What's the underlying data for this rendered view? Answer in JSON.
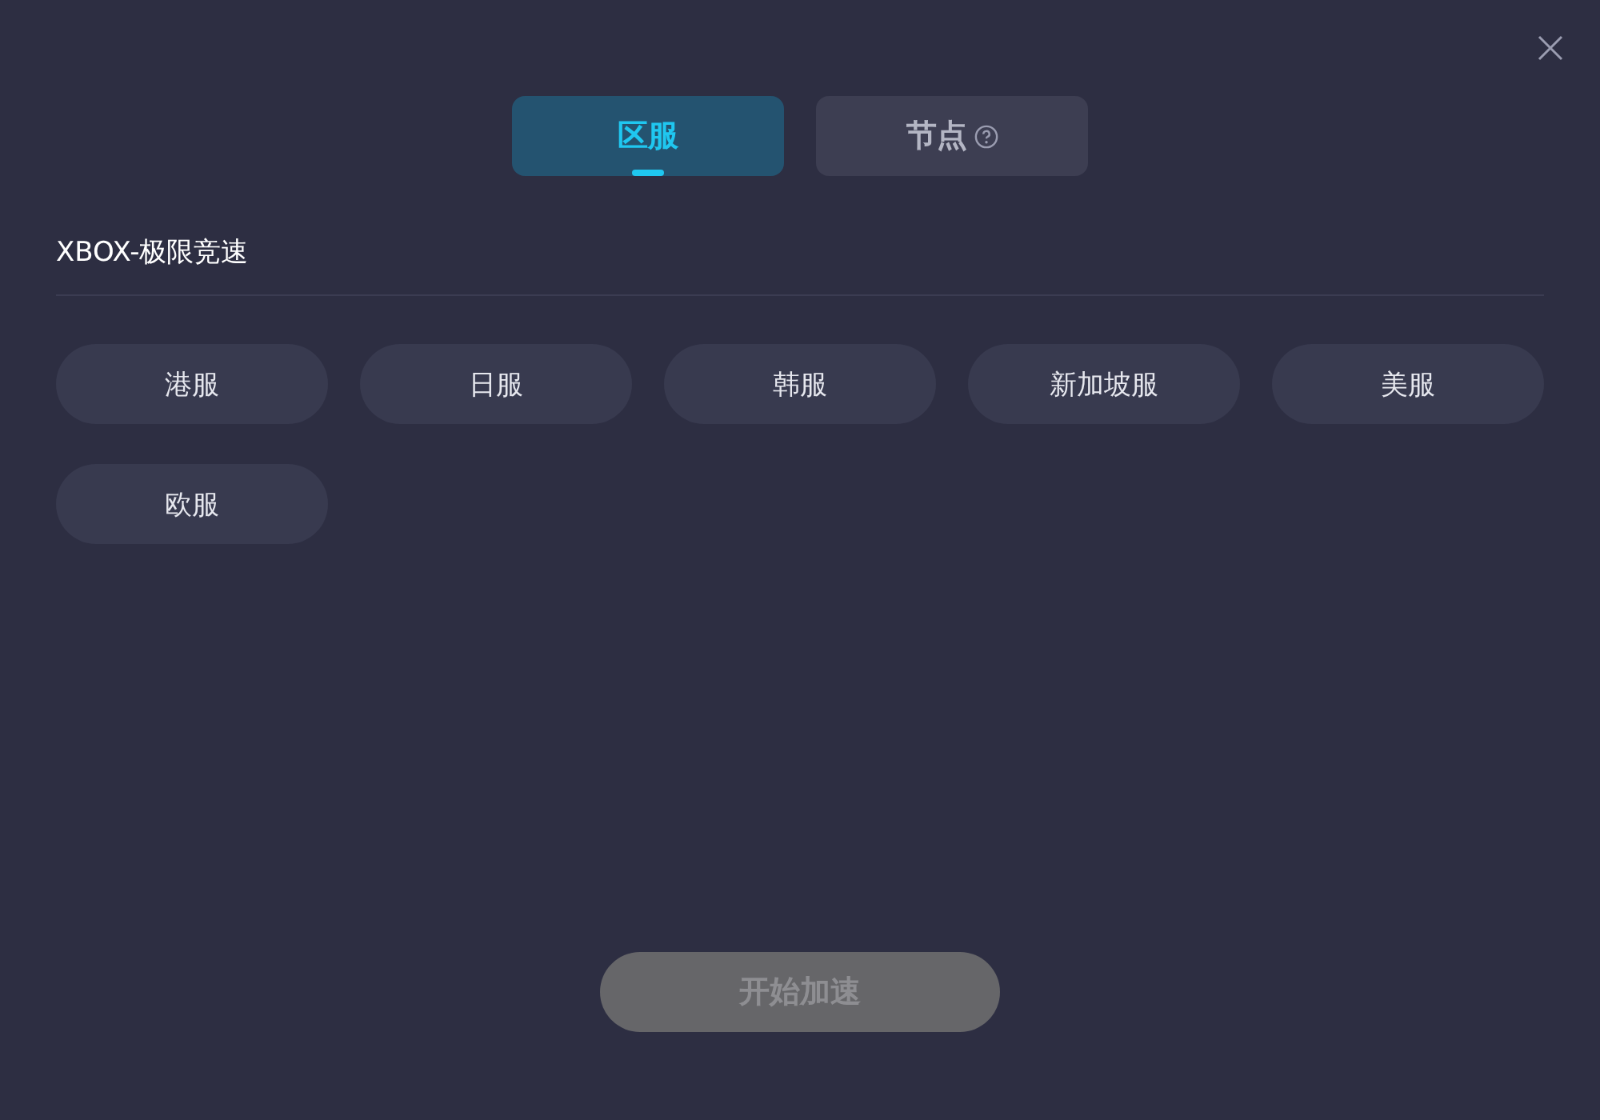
{
  "tabs": [
    {
      "label": "区服",
      "selected": true,
      "help": false
    },
    {
      "label": "节点",
      "selected": false,
      "help": true
    }
  ],
  "game_title": "XBOX-极限竞速",
  "regions": [
    {
      "label": "港服",
      "selected": false
    },
    {
      "label": "日服",
      "selected": false
    },
    {
      "label": "韩服",
      "selected": false
    },
    {
      "label": "新加坡服",
      "selected": false
    },
    {
      "label": "美服",
      "selected": false
    },
    {
      "label": "欧服",
      "selected": false
    }
  ],
  "start_button": {
    "label": "开始加速",
    "disabled": true
  }
}
